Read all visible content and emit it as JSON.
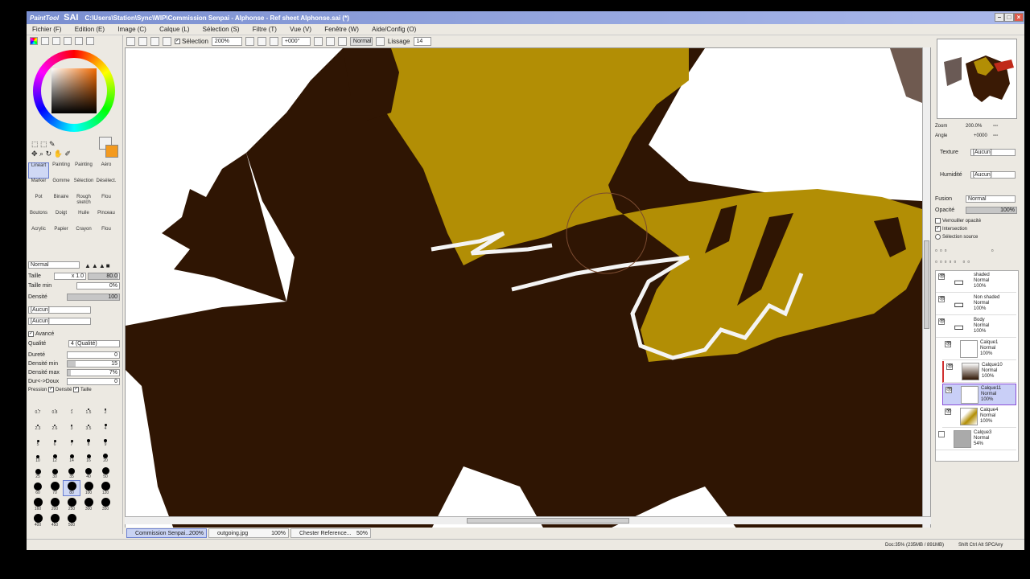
{
  "title": {
    "logo": "PaintTool",
    "sai": "SAI",
    "path": "C:\\Users\\Station\\Sync\\WIP\\Commission Senpai - Alphonse - Ref sheet Alphonse.sai (*)"
  },
  "menu": [
    "Fichier (F)",
    "Edition (E)",
    "Image (C)",
    "Calque (L)",
    "Sélection (S)",
    "Filtre (T)",
    "Vue (V)",
    "Fenêtre (W)",
    "Aide/Config (O)"
  ],
  "toolbar": {
    "selection_label": "Sélection",
    "zoom": "200%",
    "angle": "+000°",
    "mode": "Normal",
    "lissage_label": "Lissage",
    "lissage_value": "14"
  },
  "left": {
    "tools": [
      "Lineart",
      "Painting",
      "Painting",
      "Aéro",
      "Marker",
      "Gomme",
      "Sélection",
      "Désélect.",
      "Pot",
      "Binaire",
      "Rough sketch",
      "Flou",
      "Boutons",
      "Doigt",
      "Huile",
      "Pinceau",
      "Acrylic",
      "Papier",
      "Crayon",
      "Flou"
    ],
    "blend_mode": "Normal",
    "taille_label": "Taille",
    "taille_mult": "x 1.0",
    "taille_value": "80.0",
    "taille_min_label": "Taille min",
    "taille_min_value": "0%",
    "densite_label": "Densité",
    "densite_value": "100",
    "texture1": "[Aucun]",
    "texture2": "[Aucun]",
    "avance_label": "Avancé",
    "qualite_label": "Qualité",
    "qualite_value": "4 (Qualité)",
    "durete_label": "Dureté",
    "durete_value": "0",
    "densite_min_label": "Densité min",
    "densite_min_value": "15",
    "densite_max_label": "Densité max",
    "densite_max_value": "7%",
    "dur_doux_label": "Dur<->Doux",
    "dur_doux_value": "0",
    "pression_label": "Pression",
    "pression_densite": "Densité",
    "pression_taille": "Taille",
    "brush_sizes": [
      "0.7",
      "0.8",
      "1",
      "1.5",
      "2",
      "2.3",
      "2.6",
      "3",
      "3.5",
      "4",
      "5",
      "6",
      "7",
      "8",
      "9",
      "10",
      "12",
      "14",
      "16",
      "20",
      "25",
      "30",
      "35",
      "40",
      "50",
      "60",
      "70",
      "80",
      "100",
      "120",
      "160",
      "200",
      "250",
      "300",
      "350",
      "400",
      "450",
      "500"
    ]
  },
  "right": {
    "zoom_label": "Zoom",
    "zoom_value": "200.0%",
    "angle_label": "Angle",
    "angle_value": "+0000",
    "texture_label": "Texture",
    "texture_value": "[Aucun]",
    "humidite_label": "Humidité",
    "humidite_value": "[Aucun]",
    "fusion_label": "Fusion",
    "fusion_value": "Normal",
    "opacite_label": "Opacité",
    "opacite_value": "100%",
    "verrou_label": "Verrouiller opacité",
    "intersection_label": "Intersection",
    "selection_source_label": "Sélection source",
    "layers": [
      {
        "name": "shaded",
        "mode": "Normal",
        "opacity": "100%",
        "folder": true
      },
      {
        "name": "Non shaded",
        "mode": "Normal",
        "opacity": "100%",
        "folder": true
      },
      {
        "name": "Body",
        "mode": "Normal",
        "opacity": "100%",
        "folder": true
      },
      {
        "name": "Calque1",
        "mode": "Normal",
        "opacity": "100%"
      },
      {
        "name": "Calque10",
        "mode": "Normal",
        "opacity": "100%"
      },
      {
        "name": "Calque11",
        "mode": "Normal",
        "opacity": "100%",
        "selected": true
      },
      {
        "name": "Calque4",
        "mode": "Normal",
        "opacity": "100%"
      },
      {
        "name": "Calque3",
        "mode": "Normal",
        "opacity": "54%"
      }
    ]
  },
  "doc_tabs": [
    {
      "name": "Commission Senpai...",
      "zoom": "200%"
    },
    {
      "name": "outgoing.jpg",
      "zoom": "100%"
    },
    {
      "name": "Chester Reference...",
      "zoom": "50%"
    }
  ],
  "status": {
    "doc": "Doc:35% (235MB / 891MB)",
    "keys": "Shift Ctrl Alt SPC",
    "extra": "Any"
  },
  "colors": {
    "brown": "#2f1503",
    "gold": "#b28e05"
  }
}
